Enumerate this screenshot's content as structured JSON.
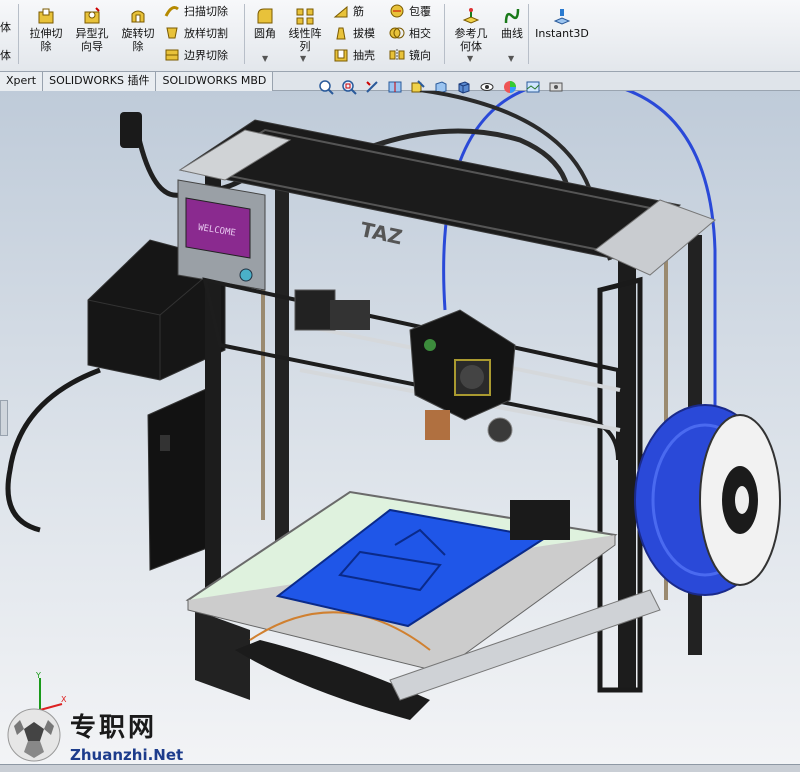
{
  "ribbon": {
    "left_clip_top": "体",
    "left_clip_bottom": "体",
    "extrude_cut": "拉伸切\n除",
    "hole_wizard": "异型孔\n向导",
    "revolve_cut": "旋转切\n除",
    "swept_cut": "扫描切除",
    "lofted_cut": "放样切割",
    "boundary_cut": "边界切除",
    "fillet": "圆角",
    "linear_pattern": "线性阵\n列",
    "rib": "筋",
    "draft": "拔模",
    "shell": "抽壳",
    "wrap": "包覆",
    "intersect": "相交",
    "mirror": "镜向",
    "reference_geometry": "参考几\n何体",
    "curves": "曲线",
    "instant3d": "Instant3D"
  },
  "tabs": [
    "Xpert",
    "SOLIDWORKS 插件",
    "SOLIDWORKS MBD"
  ],
  "model": {
    "lcd_text": "WELCOME",
    "brand_text": "TAZ"
  },
  "watermark": {
    "cn": "专职网",
    "en": "Zhuanzhi.Net"
  },
  "colors": {
    "frame": "#1c1c1c",
    "bed": "#d6f0d6",
    "print_object": "#1f56e8",
    "filament": "#2a49d8",
    "viewport_top": "#bfcbd9"
  }
}
